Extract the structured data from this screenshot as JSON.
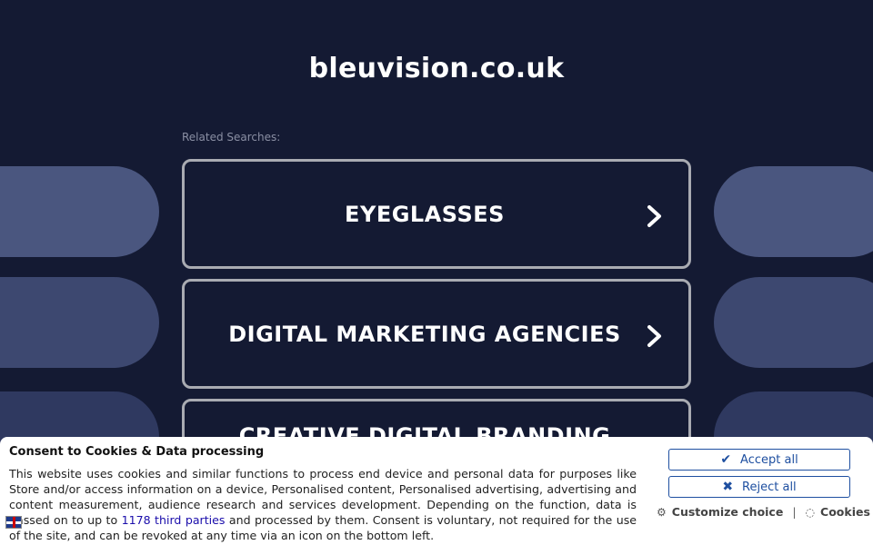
{
  "site": {
    "domain": "bleuvision.co.uk",
    "related_label": "Related Searches:"
  },
  "searches": [
    {
      "label": "EYEGLASSES"
    },
    {
      "label": "DIGITAL MARKETING AGENCIES"
    },
    {
      "label": "CREATIVE DIGITAL BRANDING"
    }
  ],
  "consent": {
    "title": "Consent to Cookies & Data processing",
    "text_before_link": "This website uses cookies and similar functions to process end device and personal data for purposes like Store and/or access information on a device, Personalised content, Personalised advertising, advertising and content measurement, audience research and services development. Depending on the function, data is passed on to up to ",
    "link_text": "1178 third parties",
    "text_after_link": " and processed by them. Consent is voluntary, not required for the use of the site, and can be revoked at any time via an icon on the bottom left.",
    "accept_label": "Accept all",
    "reject_label": "Reject all",
    "customize_label": "Customize choice",
    "cookies_label": "Cookies",
    "separator": "|"
  },
  "colors": {
    "background": "#141a33",
    "card_border": "#a9abb2",
    "button_blue": "#1e4fa0"
  }
}
